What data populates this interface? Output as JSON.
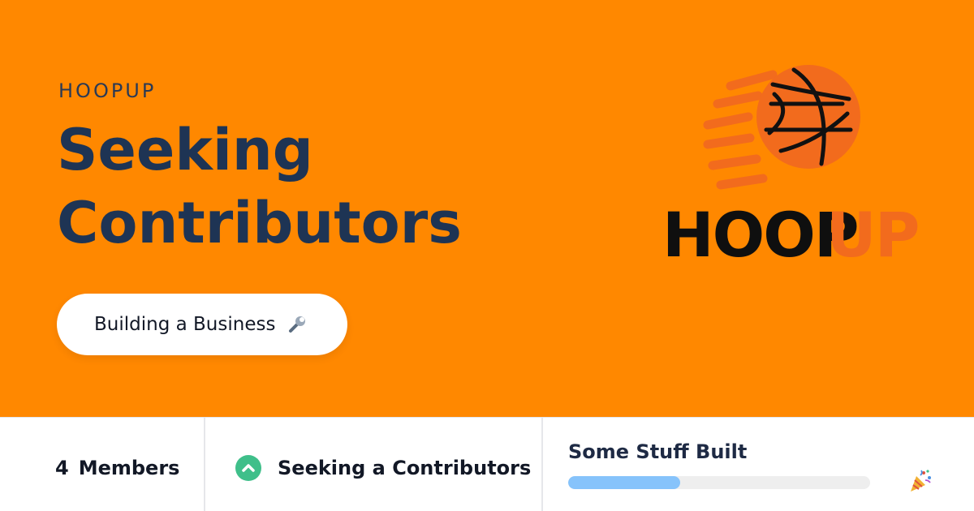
{
  "hero": {
    "eyebrow": "HOOPUP",
    "title": "Seeking Contributors",
    "pill_label": "Building a Business",
    "pill_icon": "wrench-icon",
    "background_color": "#ff8800"
  },
  "logo": {
    "icon": "basketball-icon",
    "text_primary": "HOOP",
    "text_accent": "UP"
  },
  "footer": {
    "members": {
      "count": "4",
      "label": "Members"
    },
    "status": {
      "icon": "chevron-up-icon",
      "label": "Seeking a Contributors",
      "color": "#3fbf8a"
    },
    "progress": {
      "title": "Some Stuff Built",
      "percent": 37,
      "fill_color": "#86c3fb",
      "icon": "party-popper-icon"
    }
  }
}
